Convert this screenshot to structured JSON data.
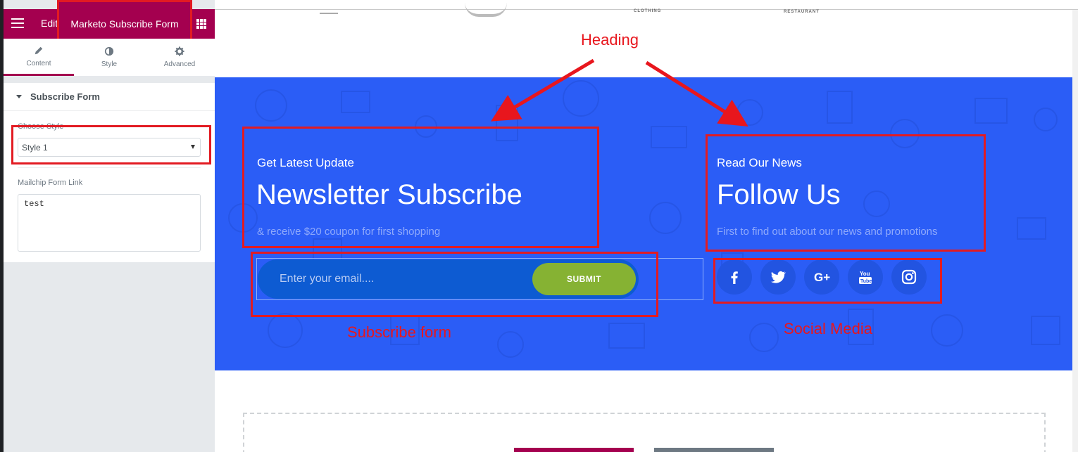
{
  "panel": {
    "header_title_short": "Edit",
    "widget_title": "Marketo Subscribe Form",
    "tabs": [
      {
        "label": "Content",
        "icon": "pencil-icon"
      },
      {
        "label": "Style",
        "icon": "half-circle-icon"
      },
      {
        "label": "Advanced",
        "icon": "gear-icon"
      }
    ],
    "section_title": "Subscribe Form",
    "choose_style_label": "Choose Style",
    "choose_style_value": "Style 1",
    "mailchimp_label": "Mailchip Form Link",
    "mailchimp_value": "test"
  },
  "preview": {
    "logo_text_1": "CLOTHING",
    "logo_text_2": "RESTAURANT",
    "newsletter": {
      "eyebrow": "Get Latest Update",
      "heading": "Newsletter Subscribe",
      "subtitle": "& receive $20 coupon for first shopping",
      "email_placeholder": "Enter your email....",
      "submit_label": "SUBMIT"
    },
    "follow": {
      "eyebrow": "Read Our News",
      "heading": "Follow Us",
      "subtitle": "First to find out about our news and promotions",
      "icons": [
        "facebook-icon",
        "twitter-icon",
        "google-plus-icon",
        "youtube-icon",
        "instagram-icon"
      ]
    }
  },
  "annotations": {
    "heading": "Heading",
    "subscribe_form": "Subscribe form",
    "social_media": "Social Media"
  },
  "colors": {
    "brand": "#a4004f",
    "banner": "#2b5df6",
    "submit": "#86b233",
    "annotation": "#e21b22"
  }
}
